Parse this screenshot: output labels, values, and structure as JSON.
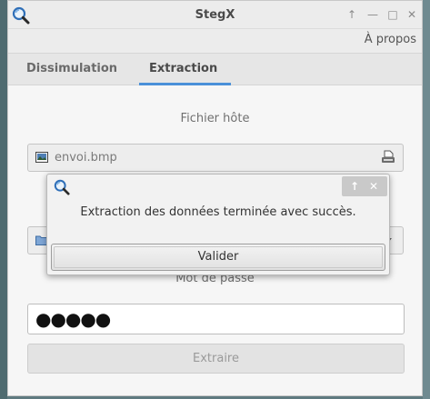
{
  "window": {
    "title": "StegX",
    "controls": {
      "up": "↑",
      "minimize": "—",
      "maximize": "□",
      "close": "✕"
    }
  },
  "menu": {
    "about": "À propos"
  },
  "tabs": [
    {
      "label": "Dissimulation",
      "active": false
    },
    {
      "label": "Extraction",
      "active": true
    }
  ],
  "form": {
    "host_file_label": "Fichier hôte",
    "host_file_value": "envoi.bmp",
    "password_label": "Mot de passe",
    "password_value": "●●●●●",
    "extract_button": "Extraire"
  },
  "dialog": {
    "message": "Extraction des données terminée avec succès.",
    "confirm_button": "Valider"
  },
  "colors": {
    "accent": "#4a90d9"
  }
}
